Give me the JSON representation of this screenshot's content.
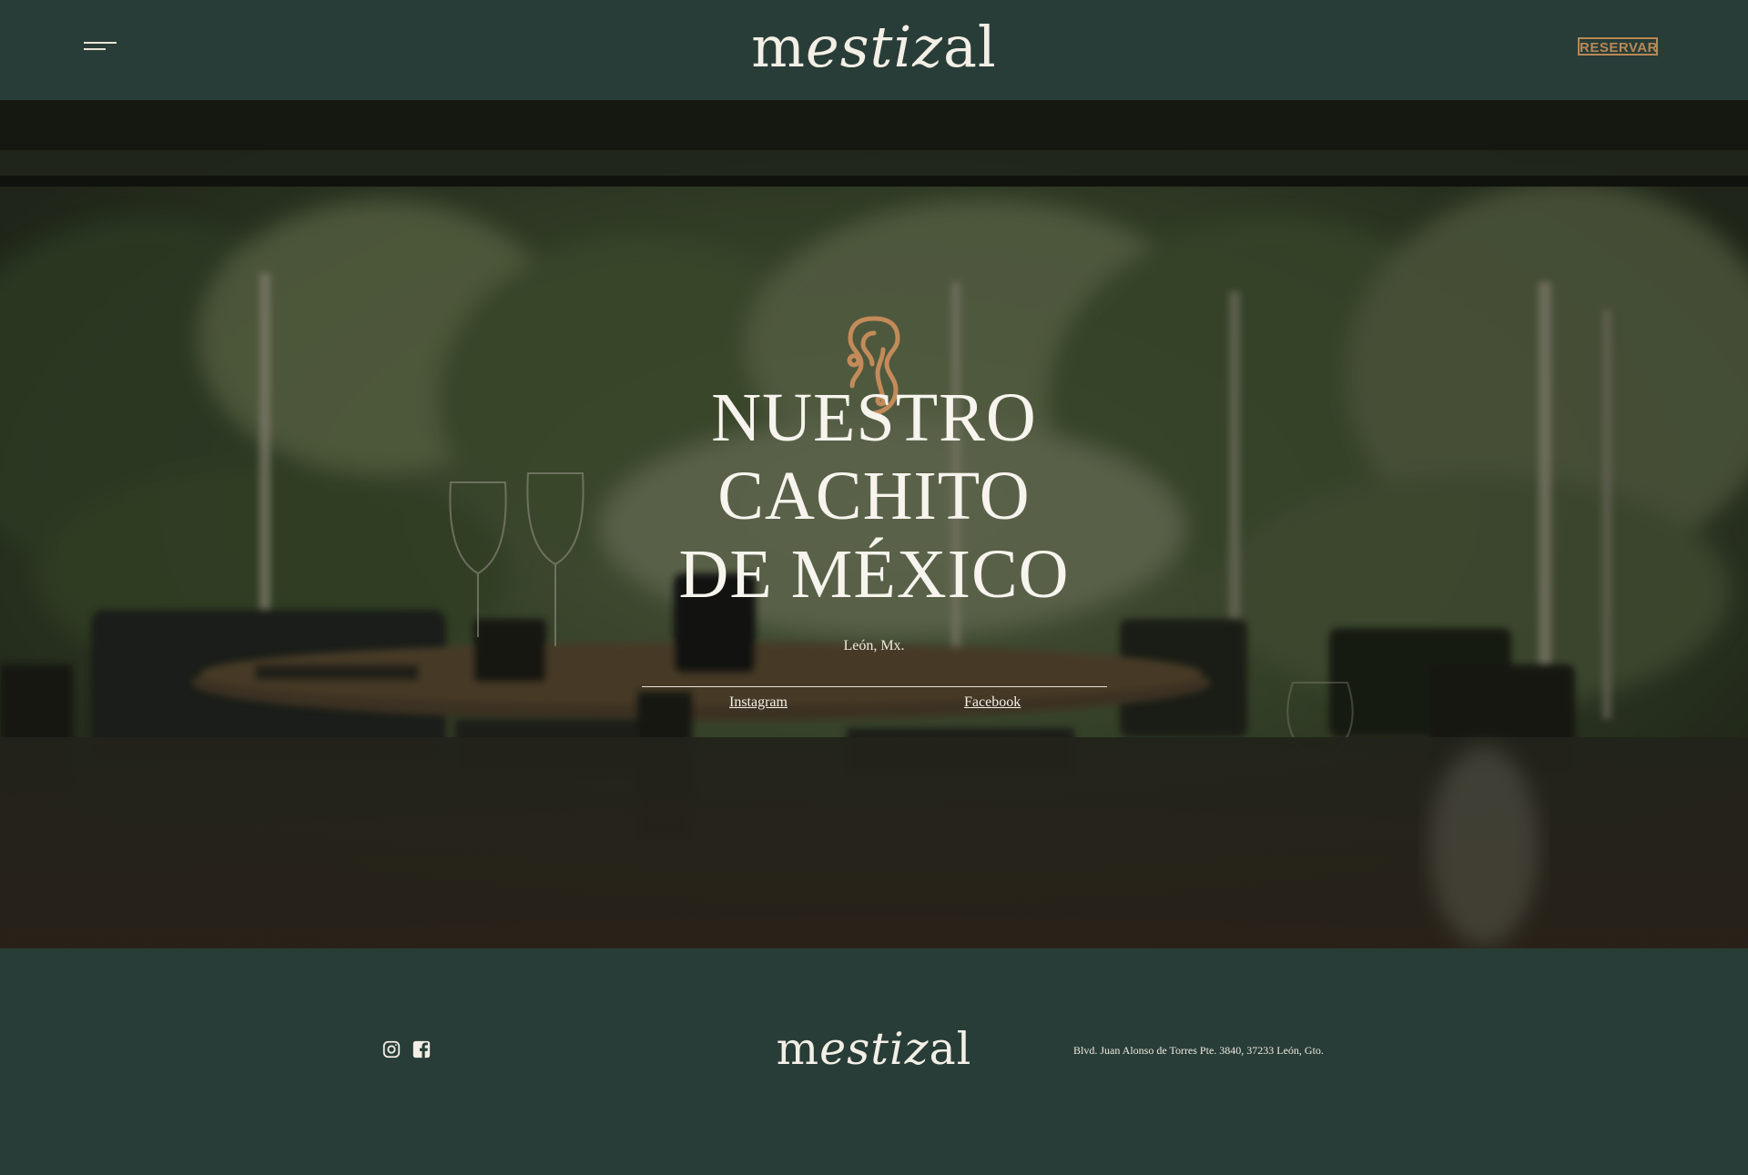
{
  "header": {
    "logo": {
      "part1": "m",
      "part2": "estiz",
      "part3": "al"
    },
    "reserve_label": "RESERVAR"
  },
  "hero": {
    "title_lines": [
      "NUESTRO",
      "CACHITO",
      "DE MÉXICO"
    ],
    "location": "León, Mx.",
    "links": {
      "instagram": "Instagram",
      "facebook": "Facebook"
    }
  },
  "footer": {
    "logo": {
      "part1": "m",
      "part2": "estiz",
      "part3": "al"
    },
    "address": "Blvd. Juan Alonso de Torres Pte. 3840, 37233 León, Gto."
  },
  "colors": {
    "background": "#283d37",
    "accent": "#b98856",
    "text": "#f3efe6"
  },
  "icons": {
    "menu": "hamburger-menu-icon",
    "emblem": "brand-emblem-icon",
    "instagram": "instagram-icon",
    "facebook": "facebook-icon"
  }
}
